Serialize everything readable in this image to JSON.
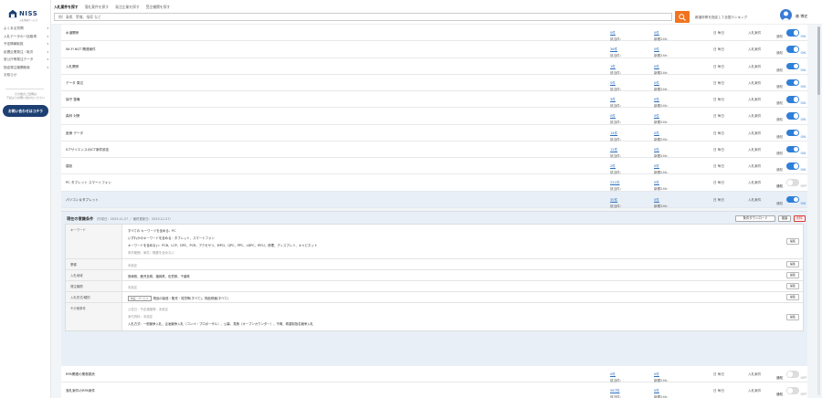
{
  "sidebar": {
    "logo_text": "NISS",
    "logo_sub": "入札情報サービス",
    "menu": [
      {
        "label": "よくある質問",
        "caret": "▾"
      },
      {
        "label": "入札データの一括取得",
        "caret": "▾"
      },
      {
        "label": "予定情報取扱",
        "caret": "▾"
      },
      {
        "label": "民間企業発注・取次",
        "caret": "▾"
      },
      {
        "label": "官公庁等発注データ",
        "caret": "▾"
      },
      {
        "label": "指定発注機関検索",
        "caret": "▾"
      },
      {
        "label": "お知らせ",
        "caret": ""
      }
    ],
    "note": "その他のご質問は\n下記よりお問い合わせください",
    "contact_label": "お問い合わせはコチラ"
  },
  "header": {
    "tabs": [
      "入札案件を探す",
      "落札案件を探す",
      "発注企業を探す",
      "受注機関を探す"
    ],
    "search_placeholder": "例）清掃、警備、指導 など",
    "ranking_link": "都道府県を指定して全国ランキング",
    "user_name": "森 博史"
  },
  "labels": {
    "all_prefix": "該当件：",
    "new_prefix": "新着24h：",
    "freq_value": "日 毎日",
    "type_value": "入札案件",
    "toggle_label": "通知",
    "on": "ON",
    "off": "OFF"
  },
  "rows": [
    {
      "name": "水道関係",
      "all": "0件",
      "new": "0件",
      "on": true
    },
    {
      "name": "Wi-Fi NGT 関連案件",
      "all": "36件",
      "new": "0件",
      "on": true
    },
    {
      "name": "入札関係",
      "all": "1件",
      "new": "0件",
      "on": true
    },
    {
      "name": "データ 周辺",
      "all": "5件",
      "new": "0件",
      "on": true
    },
    {
      "name": "保守 整備",
      "all": "3件",
      "new": "0件",
      "on": true
    },
    {
      "name": "森林 対策",
      "all": "0件",
      "new": "0件",
      "on": true
    },
    {
      "name": "医療 データ",
      "all": "14件",
      "new": "0件",
      "on": true
    },
    {
      "name": "ICTサイエンスのICT案件設定",
      "all": "12件",
      "new": "0件",
      "on": true
    },
    {
      "name": "建設",
      "all": "2件",
      "new": "0件",
      "on": true
    },
    {
      "name": "PC タブレット スマートフォン",
      "all": "221件",
      "new": "0件",
      "on": false
    },
    {
      "name": "パソコン＆タブレット",
      "all": "30件",
      "new": "0件",
      "on": true,
      "selected": true
    }
  ],
  "detail": {
    "title": "現在の意識条件",
    "meta": "（作成日：2023.11.27 ／ 最終更新日：2023.11.27）",
    "btn_save": "条件ダウンロード",
    "btn_copy": "複製",
    "btn_delete": "削除",
    "edit_label": "編集",
    "conditions": [
      {
        "label": "キーワード",
        "values": [
          {
            "text": "すべての キーワードを含める：PC",
            "muted": false
          },
          {
            "text": "いずれかのキーワードを含める：タブレット、スマートフォン",
            "muted": false
          },
          {
            "text": "キーワードを含めない：PCB、LCP、DPC、PCR、アクセサリ、MPCI、QPC、PPC、LDPC、IPCU、修理、ディスプレイ、キャビネット",
            "muted": false
          },
          {
            "text": "条件範囲：案件／概要を含めない",
            "muted": true
          }
        ]
      },
      {
        "label": "業種",
        "values": [
          {
            "text": "未設定",
            "muted": true
          }
        ]
      },
      {
        "label": "入札地域",
        "values": [
          {
            "text": "長崎県、鹿児島県、福岡県、佐賀県、千葉県",
            "muted": false
          }
        ]
      },
      {
        "label": "発注機関",
        "values": [
          {
            "text": "未設定",
            "muted": true
          }
        ]
      },
      {
        "label": "入札形式/種別",
        "tag": "物品・サービス",
        "values": [
          {
            "text": "物品の製造・販売・賃貸等(すべて)、物品修繕(すべて)",
            "muted": false
          }
        ]
      },
      {
        "label": "その他条件",
        "values": [
          {
            "text": "公告日・予定価格等：未設定",
            "muted": true
          },
          {
            "text": "添付資料：未設定",
            "muted": true
          },
          {
            "text": "入札方式：一般競争入札、企画競争入札（コンペ・プロポーザル）、公募、見積（オープンカウンター）、不明、希望制指名競争入札",
            "muted": false
          }
        ]
      }
    ]
  },
  "rows2": [
    {
      "name": "RPA関連の業務委託",
      "all": "0件",
      "new": "0件",
      "on": false
    },
    {
      "name": "落札案件のRPA案件",
      "all": "567件",
      "new": "0件",
      "on": false
    }
  ],
  "colors": {
    "accent": "#2f7fd8",
    "brand": "#1d3f72",
    "search": "#f07420"
  }
}
